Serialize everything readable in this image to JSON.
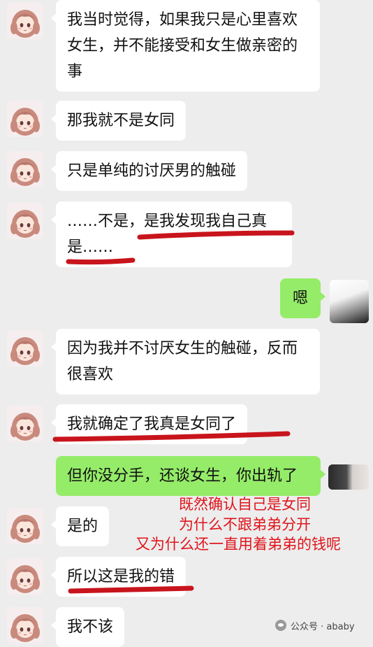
{
  "messages": [
    {
      "side": "left",
      "avatar_icon": "anime-girl-avatar",
      "lines": [
        "我当时觉得，如果我只是心里喜欢",
        "女生，并不能接受和女生做亲密的",
        "事"
      ]
    },
    {
      "side": "left",
      "avatar_icon": "anime-girl-avatar",
      "lines": [
        "那我就不是女同"
      ]
    },
    {
      "side": "left",
      "avatar_icon": "anime-girl-avatar",
      "lines": [
        "只是单纯的讨厌男的触碰"
      ]
    },
    {
      "side": "left",
      "avatar_icon": "anime-girl-avatar",
      "lines": [
        "……不是，是我发现我自己真",
        "是……"
      ]
    },
    {
      "side": "right",
      "avatar_icon": "blurred-avatar",
      "lines": [
        "嗯"
      ]
    },
    {
      "side": "left",
      "avatar_icon": "anime-girl-avatar",
      "lines": [
        "因为我并不讨厌女生的触碰，反而",
        "很喜欢"
      ]
    },
    {
      "side": "left",
      "avatar_icon": "anime-girl-avatar",
      "lines": [
        "我就确定了我真是女同了"
      ]
    },
    {
      "side": "right",
      "avatar_icon": "blurred-avatar",
      "lines": [
        "但你没分手，还谈女生，你出轨了"
      ]
    },
    {
      "side": "left",
      "avatar_icon": "anime-girl-avatar",
      "lines": [
        "是的"
      ]
    },
    {
      "side": "left",
      "avatar_icon": "anime-girl-avatar",
      "lines": [
        "所以这是我的错"
      ]
    },
    {
      "side": "left",
      "avatar_icon": "anime-girl-avatar",
      "lines": [
        "我不该"
      ]
    }
  ],
  "annotation": {
    "lines": [
      "既然确认自己是女同",
      "为什么不跟弟弟分开",
      "又为什么还一直用着弟弟的钱呢"
    ],
    "color": "#e0141b"
  },
  "watermark": {
    "text": "公众号 · ababy",
    "icon": "wechat-official-account-icon"
  },
  "colors": {
    "background": "#ededed",
    "left_bubble": "#ffffff",
    "right_bubble": "#95ec69",
    "underline": "#c8141c"
  }
}
